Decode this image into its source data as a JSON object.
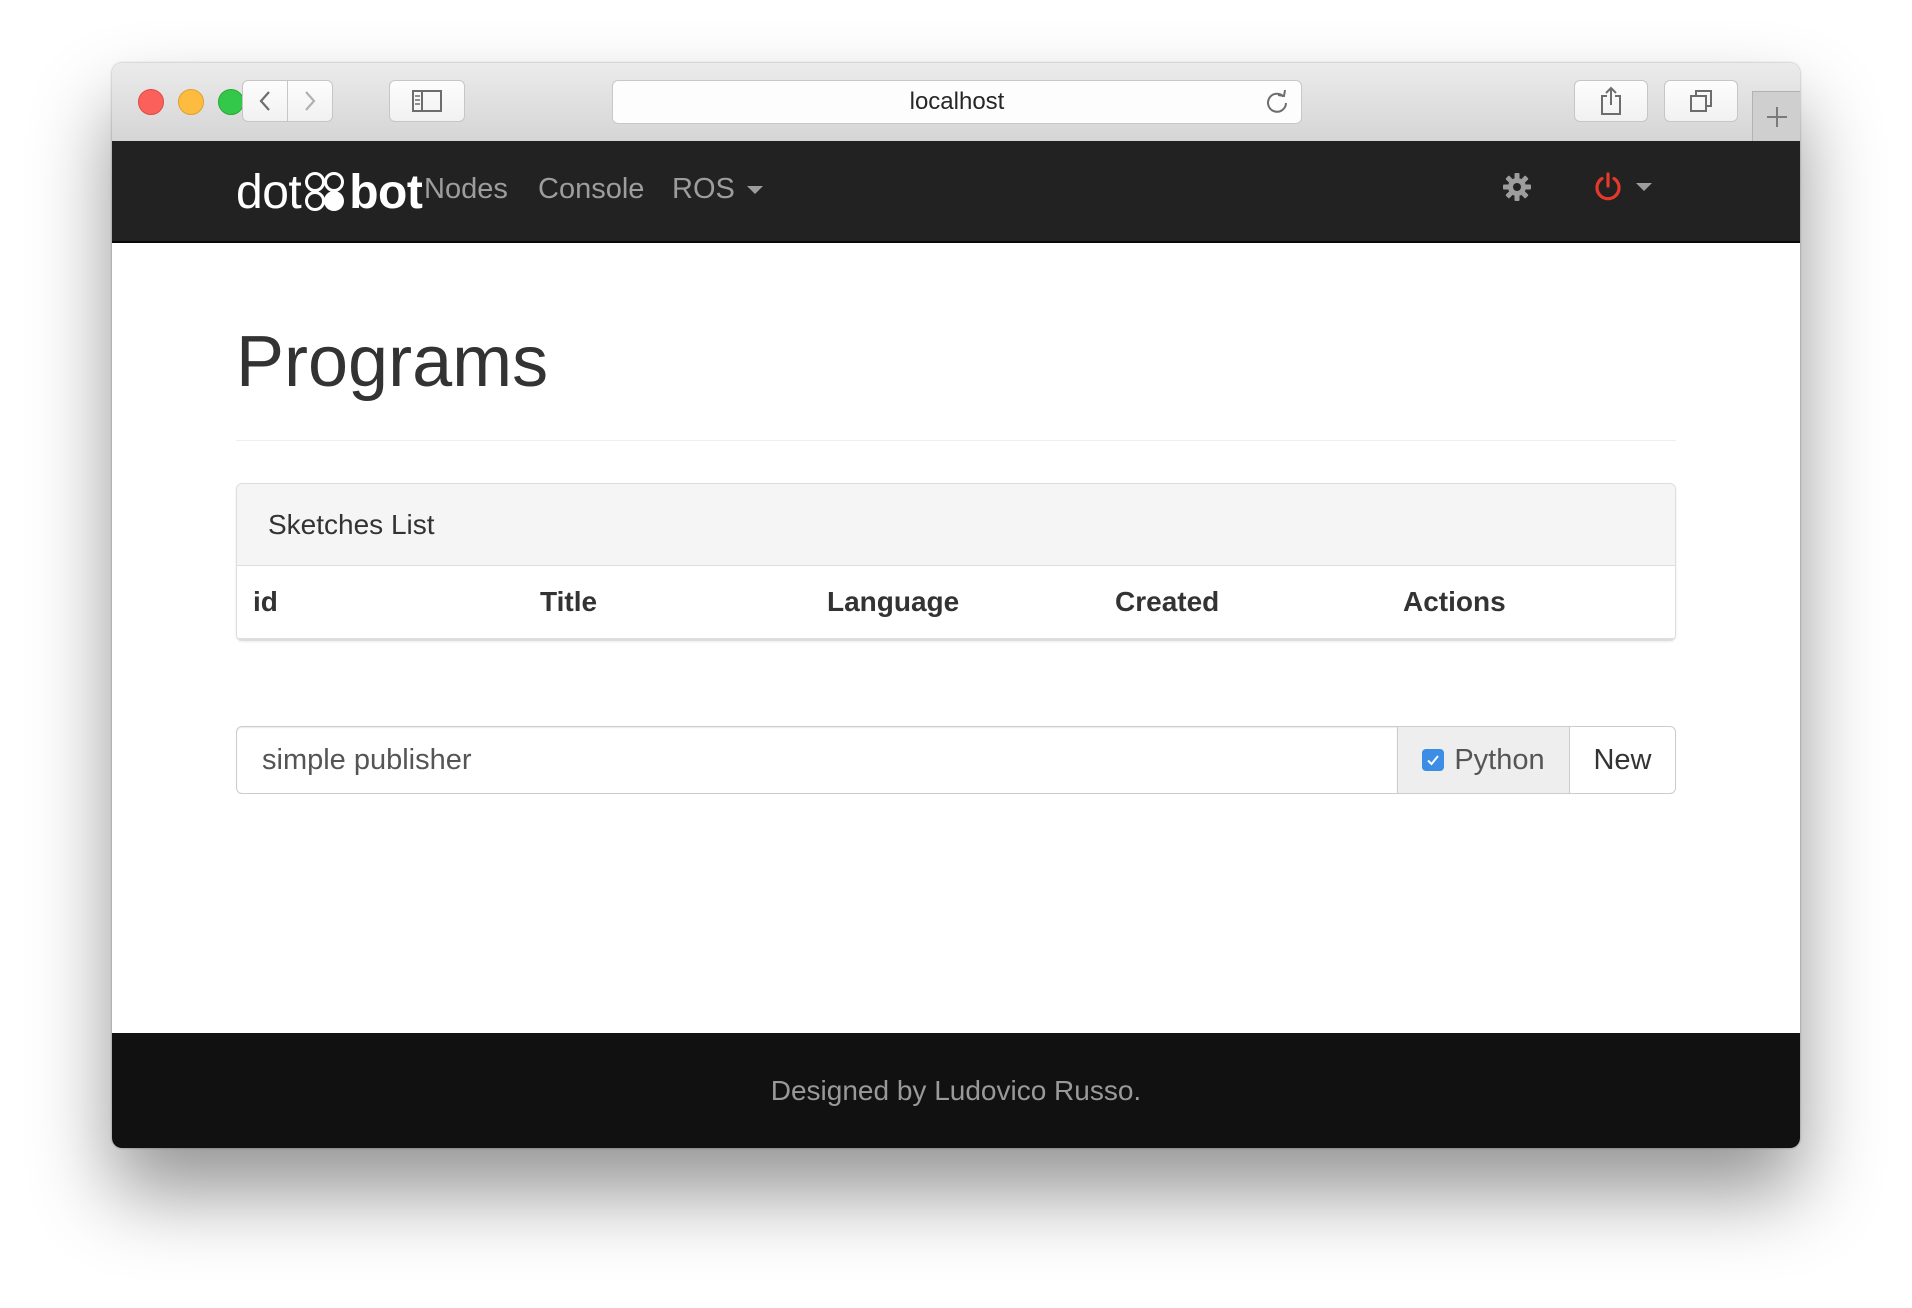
{
  "browser": {
    "url": "localhost",
    "icons": {
      "back": "chevron-left-icon",
      "forward": "chevron-right-icon",
      "sidebar": "sidebar-icon",
      "reload": "reload-icon",
      "share": "share-icon",
      "tabs": "tabs-icon",
      "new_tab": "plus-icon"
    }
  },
  "navbar": {
    "brand_left": "dot",
    "brand_right": "bot",
    "links": [
      "Nodes",
      "Console",
      "ROS"
    ],
    "settings_icon": "gear-icon",
    "power_icon": "power-icon",
    "power_color": "#e4392b"
  },
  "page": {
    "title": "Programs"
  },
  "panel": {
    "heading": "Sketches List",
    "columns": [
      "id",
      "Title",
      "Language",
      "Created",
      "Actions"
    ]
  },
  "new_sketch": {
    "input_value": "simple publisher",
    "python_label": "Python",
    "python_checked": true,
    "new_button": "New"
  },
  "footer": {
    "text": "Designed by Ludovico Russo."
  }
}
